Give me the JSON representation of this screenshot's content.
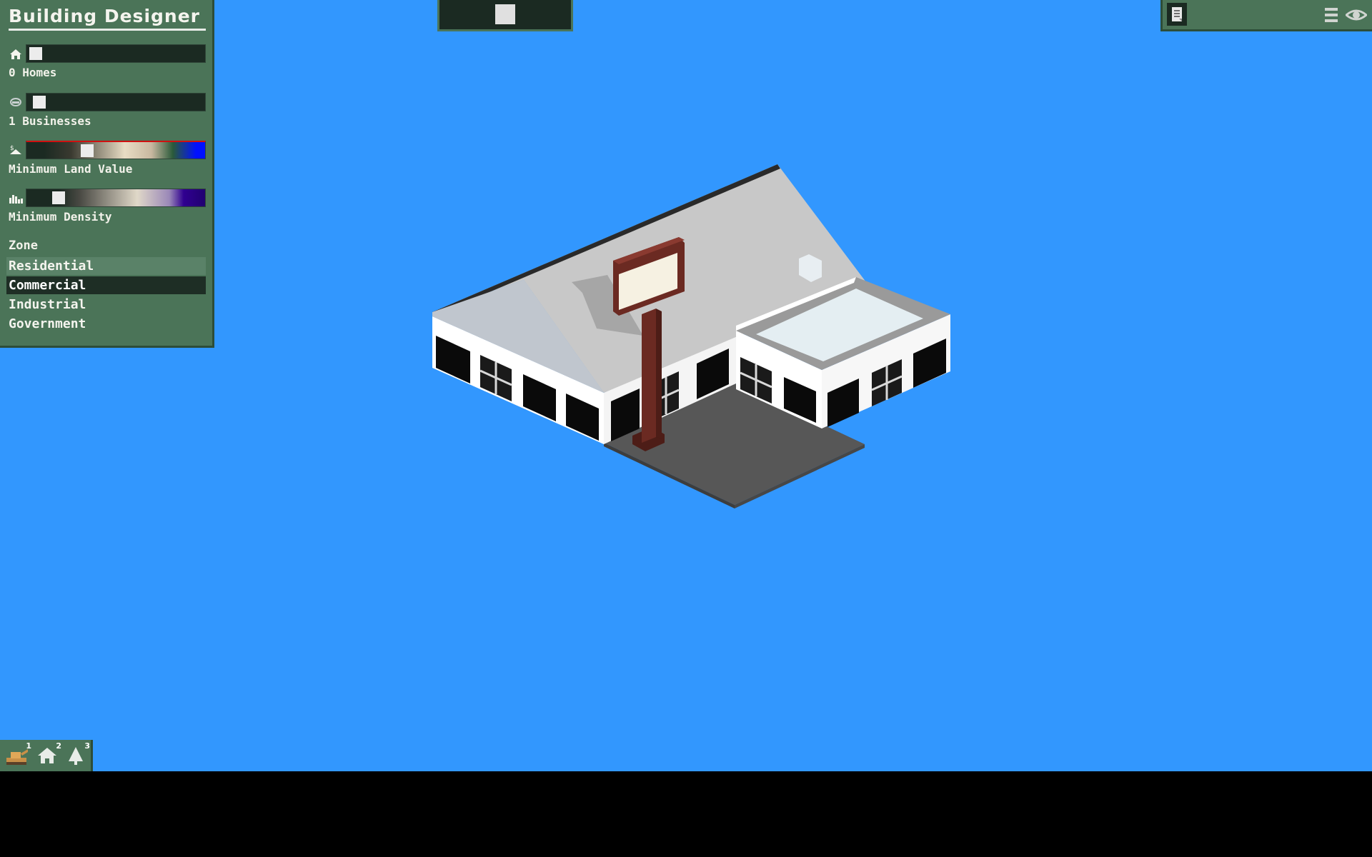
{
  "panel": {
    "title": "Building Designer",
    "homes": {
      "label": "0 Homes",
      "icon": "home-icon",
      "value": 0
    },
    "businesses": {
      "label": "1 Businesses",
      "icon": "business-icon",
      "value": 0.02
    },
    "land_value": {
      "label": "Minimum Land Value",
      "icon": "land-value-icon",
      "value": 0.32
    },
    "density": {
      "label": "Minimum Density",
      "icon": "density-icon",
      "value": 0.14
    },
    "zone": {
      "heading": "Zone",
      "items": [
        "Residential",
        "Commercial",
        "Industrial",
        "Government"
      ],
      "selected": "Commercial"
    }
  },
  "top_center_slider": {
    "value": 0.5
  },
  "top_right": {
    "icons": [
      "document-icon",
      "menu-icon",
      "eye-icon"
    ]
  },
  "toolbar": {
    "tools": [
      {
        "icon": "bulldozer-icon",
        "number": "1"
      },
      {
        "icon": "house-icon",
        "number": "2"
      },
      {
        "icon": "tree-icon",
        "number": "3"
      }
    ]
  },
  "colors": {
    "sky": "#3297fe",
    "panel": "#4b7458",
    "panel_dark": "#1b2a22",
    "roof": "#c8c8c8",
    "wall": "#ffffff",
    "sign_post": "#6b2a22",
    "pavement": "#565656"
  }
}
